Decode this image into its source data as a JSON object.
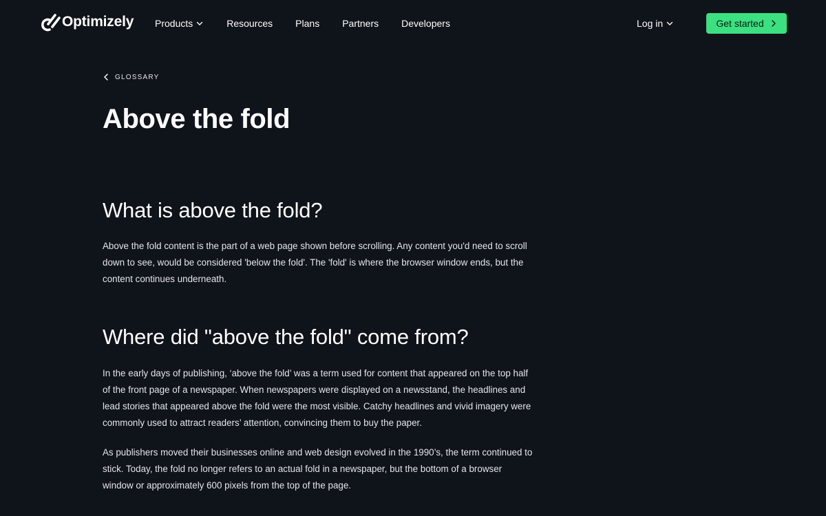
{
  "header": {
    "logo_text": "Optimizely",
    "nav": {
      "products": "Products",
      "resources": "Resources",
      "plans": "Plans",
      "partners": "Partners",
      "developers": "Developers"
    },
    "login_label": "Log in",
    "cta_label": "Get started"
  },
  "breadcrumb": {
    "label": "GLOSSARY"
  },
  "article": {
    "title": "Above the fold",
    "sections": [
      {
        "heading": "What is above the fold?",
        "paragraphs": [
          "Above the fold content is the part of a web page shown before scrolling. Any content you'd need to scroll down to see, would be considered 'below the fold'. The 'fold' is where the browser window ends, but the content continues underneath."
        ]
      },
      {
        "heading": "Where did \"above the fold\" come from?",
        "paragraphs": [
          "In the early days of publishing, ‘above the fold’ was a term used for content that appeared on the top half of the front page of a newspaper. When newspapers were displayed on a newsstand, the headlines and lead stories that appeared above the fold were the most visible. Catchy headlines and vivid imagery were commonly used to attract readers’ attention, convincing them to buy the paper.",
          "As publishers moved their businesses online and web design evolved in the 1990’s, the term continued to stick. Today, the fold no longer refers to an actual fold in a newspaper, but the bottom of a browser window or approximately 600 pixels from the top of the page."
        ]
      }
    ]
  },
  "icons": {
    "logo": "optimizely-logo-icon",
    "products_dropdown": "chevron-down-icon",
    "login_dropdown": "chevron-down-icon",
    "cta": "chevron-right-icon",
    "breadcrumb_back": "chevron-left-icon"
  },
  "colors": {
    "background": "#0f131a",
    "text": "#ffffff",
    "accent": "#3be081",
    "cta_text": "#0b1b12"
  }
}
